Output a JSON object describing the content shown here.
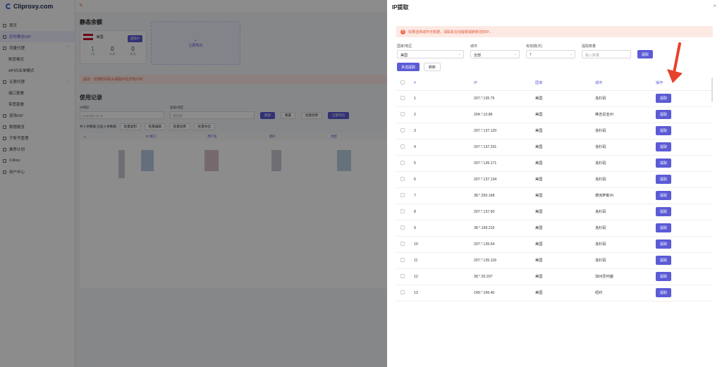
{
  "app": {
    "logo_text": "Cliproxy.com"
  },
  "sidebar": {
    "items": [
      {
        "label": "首页",
        "sub": false,
        "active": false
      },
      {
        "label": "实时静态ISP",
        "sub": false,
        "active": true
      },
      {
        "label": "流量代理",
        "sub": false,
        "active": false,
        "chev": "⌃"
      },
      {
        "label": "账密模式",
        "sub": true,
        "active": false
      },
      {
        "label": "API白名单模式",
        "sub": true,
        "active": false
      },
      {
        "label": "无限代理",
        "sub": false,
        "active": false,
        "chev": "⌃"
      },
      {
        "label": "端口套餐",
        "sub": true,
        "active": false
      },
      {
        "label": "带宽套餐",
        "sub": true,
        "active": false
      },
      {
        "label": "现场ISP",
        "sub": false,
        "active": false
      },
      {
        "label": "数据概览",
        "sub": false,
        "active": false
      },
      {
        "label": "子账号管理",
        "sub": false,
        "active": false
      },
      {
        "label": "推荐计划",
        "sub": false,
        "active": false
      },
      {
        "label": "Cdkey",
        "sub": false,
        "active": false
      },
      {
        "label": "用户中心",
        "sub": false,
        "active": false
      }
    ]
  },
  "main": {
    "balance_title": "静态余额",
    "card": {
      "country": "美国",
      "renew_label": "提取IP",
      "stats": [
        {
          "value": "1",
          "label": "7天"
        },
        {
          "value": "0",
          "label": "30天"
        },
        {
          "value": "0",
          "label": "90天"
        }
      ]
    },
    "add_label": "立即购买",
    "warning": "提示：近期时间段从提取IP后开始计时",
    "usage_title": "使用记录",
    "filters": {
      "ip_label": "IP网段",
      "ip_placeholder": "example 18.24",
      "region_label": "国家/地区",
      "region_placeholder": "请选择",
      "search": "搜索",
      "reset": "重置",
      "renew_all": "批量续费",
      "export_all": "全部导出"
    },
    "batch": {
      "selected": "共 0 条数据 已选 0 条数据",
      "buttons": [
        "批量复制",
        "批量编辑",
        "批量续费",
        "批量导出"
      ]
    },
    "table_headers": [
      "#",
      "IP:端口",
      "用户名",
      "密码",
      "地区"
    ]
  },
  "drawer": {
    "title": "IP提取",
    "close_icon": "×",
    "notice": "如果选择城市无数据，请联系在线客服或刷新您的IP。",
    "form": {
      "country_label": "国家/地区",
      "country_value": "美国",
      "city_label": "城市",
      "city_value": "全部",
      "validity_label": "有效期(天)",
      "validity_value": "7",
      "quantity_label": "提取数量",
      "quantity_placeholder": "输入数量",
      "extract_button": "提取"
    },
    "multi_extract": "多选提取",
    "refresh": "刷新",
    "columns": [
      "#",
      "IP",
      "国家",
      "城市",
      "操作"
    ],
    "rows": [
      {
        "no": "1",
        "ip": "207.*.135.75",
        "country": "美国",
        "city": "洛杉矶",
        "action": "提取"
      },
      {
        "no": "2",
        "ip": "204.*.10.86",
        "country": "美国",
        "city": "弗吉尼亚州",
        "action": "提取"
      },
      {
        "no": "3",
        "ip": "207.*.137.120",
        "country": "美国",
        "city": "洛杉矶",
        "action": "提取"
      },
      {
        "no": "4",
        "ip": "207.*.137.231",
        "country": "美国",
        "city": "洛杉矶",
        "action": "提取"
      },
      {
        "no": "5",
        "ip": "207.*.135.171",
        "country": "美国",
        "city": "洛杉矶",
        "action": "提取"
      },
      {
        "no": "6",
        "ip": "207.*.137.134",
        "country": "美国",
        "city": "洛杉矶",
        "action": "提取"
      },
      {
        "no": "7",
        "ip": "38.*.250.168",
        "country": "美国",
        "city": "德克萨斯州",
        "action": "提取"
      },
      {
        "no": "8",
        "ip": "207.*.137.60",
        "country": "美国",
        "city": "洛杉矶",
        "action": "提取"
      },
      {
        "no": "9",
        "ip": "38.*.199.215",
        "country": "美国",
        "city": "洛杉矶",
        "action": "提取"
      },
      {
        "no": "10",
        "ip": "207.*.135.54",
        "country": "美国",
        "city": "洛杉矶",
        "action": "提取"
      },
      {
        "no": "11",
        "ip": "207.*.135.118",
        "country": "美国",
        "city": "洛杉矶",
        "action": "提取"
      },
      {
        "no": "12",
        "ip": "38.*.20.207",
        "country": "美国",
        "city": "加州圣何塞",
        "action": "提取"
      },
      {
        "no": "13",
        "ip": "149.*.166.40",
        "country": "美国",
        "city": "纽约",
        "action": "提取"
      }
    ]
  },
  "colors": {
    "accent": "#5b5bd6",
    "warning_bg": "#fde9e3",
    "warning_text": "#e05a3a",
    "arrow": "#e8412a"
  }
}
